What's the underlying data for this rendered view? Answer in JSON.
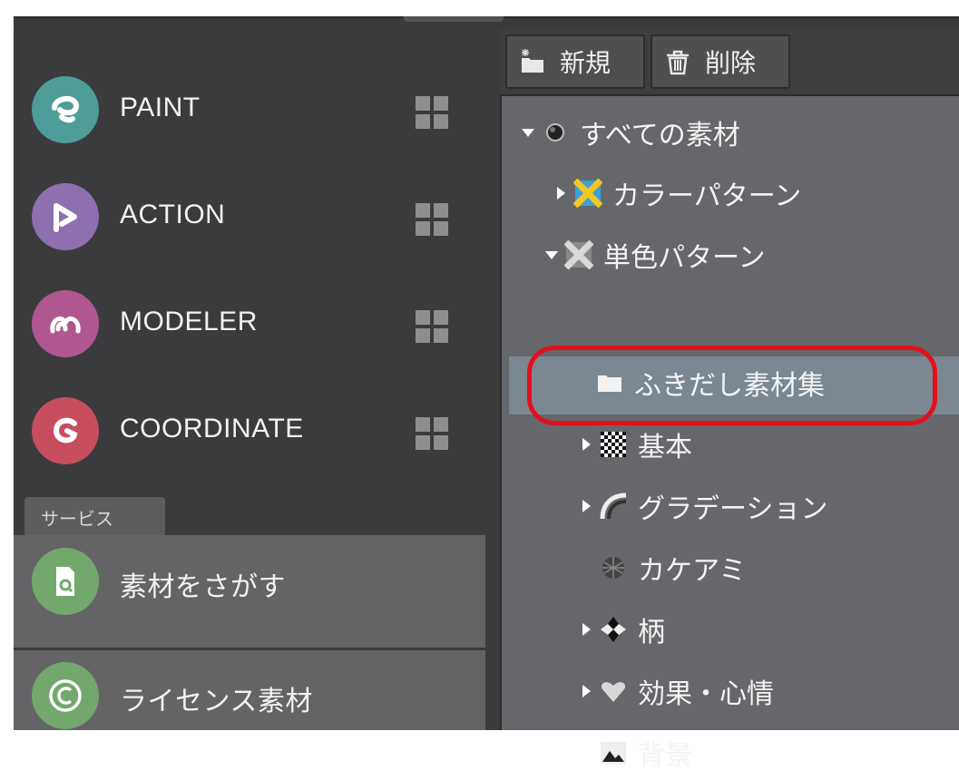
{
  "apps": [
    {
      "label": "PAINT",
      "color": "#4e9d98",
      "icon": "paint-logo"
    },
    {
      "label": "ACTION",
      "color": "#8e6fb0",
      "icon": "action-logo"
    },
    {
      "label": "MODELER",
      "color": "#b0578f",
      "icon": "modeler-logo"
    },
    {
      "label": "COORDINATE",
      "color": "#c74e5f",
      "icon": "coordinate-logo"
    }
  ],
  "services": {
    "tab_label": "サービス",
    "items": [
      {
        "label": "素材をさがす",
        "color": "#73a86c",
        "icon": "search-material-icon"
      },
      {
        "label": "ライセンス素材",
        "color": "#73a86c",
        "icon": "copyright-icon"
      }
    ]
  },
  "toolbar": {
    "new_label": "新規",
    "delete_label": "削除"
  },
  "tree": {
    "items": [
      {
        "label": "すべての素材",
        "expanded": true,
        "icon": "all-materials-icon"
      },
      {
        "label": "カラーパターン",
        "expanded": false,
        "icon": "color-pattern-icon"
      },
      {
        "label": "単色パターン",
        "expanded": true,
        "icon": "mono-pattern-icon"
      },
      {
        "label": "ふきだし素材集",
        "selected": true,
        "icon": "folder-icon"
      },
      {
        "label": "基本",
        "expanded": false,
        "icon": "checker-icon"
      },
      {
        "label": "グラデーション",
        "expanded": false,
        "icon": "gradation-icon"
      },
      {
        "label": "カケアミ",
        "icon": "kakeami-icon"
      },
      {
        "label": "柄",
        "expanded": false,
        "icon": "pattern-icon"
      },
      {
        "label": "効果・心情",
        "expanded": false,
        "icon": "heart-icon"
      },
      {
        "label": "背景",
        "expanded": false,
        "icon": "background-icon"
      }
    ]
  },
  "colors": {
    "panel_dark": "#3b3b3d",
    "tree_bg": "#66676a",
    "selected_bg": "#7b8892",
    "highlight_ring": "#e30f1c"
  }
}
